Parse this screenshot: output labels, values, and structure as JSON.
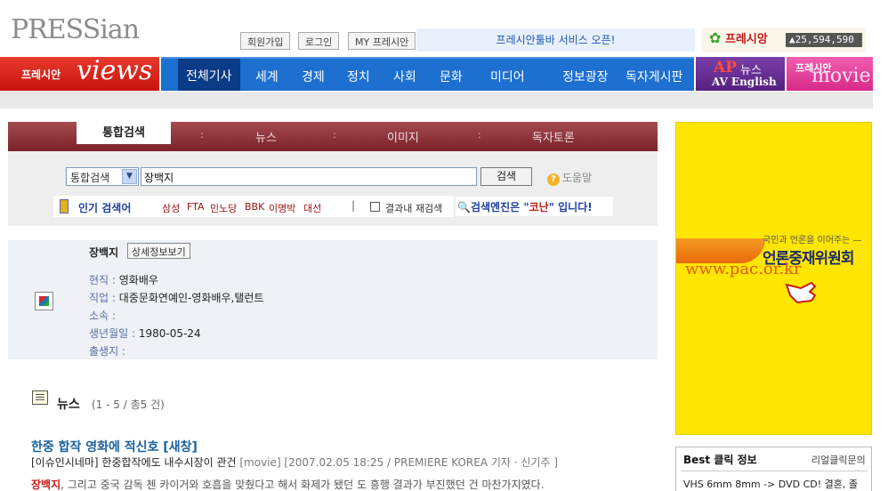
{
  "header": {
    "logo": "PRESSian",
    "links": [
      "회원가입",
      "로그인",
      "MY 프레시안"
    ],
    "banner": "프레시안툴바 서비스 오픈!",
    "counter_logo": "프레시앙",
    "counter_value": "▲25,594,590"
  },
  "nav": {
    "views_small": "프레시안",
    "views_big": "views",
    "items": [
      "전체기사",
      "세계",
      "경제",
      "정치",
      "사회",
      "문화",
      "미디어",
      "정보광장",
      "독자게시판"
    ],
    "ap_brand": "AP",
    "ap_label": "뉴스",
    "ap_sub": "AV English",
    "movie_small": "프레시안",
    "movie_big": "movie"
  },
  "search": {
    "tabs": [
      "통합검색",
      "뉴스",
      "이미지",
      "독자토론"
    ],
    "scope_value": "통합검색",
    "query": "장백지",
    "button": "검색",
    "help": "도움말",
    "popular_label": "인기 검색어",
    "popular": [
      "삼성",
      "FTA",
      "민노당",
      "BBK",
      "이명박",
      "대선"
    ],
    "research_label": "결과내 재검색",
    "engine_prefix": "검색엔진은 \"",
    "engine_name": "코난",
    "engine_suffix": "\" 입니다!"
  },
  "profile": {
    "name": "장백지",
    "detail_button": "상세정보보기",
    "rows": [
      {
        "key": "현직",
        "value": "영화배우"
      },
      {
        "key": "직업",
        "value": "대중문화연예인-영화배우,탤런트"
      },
      {
        "key": "소속",
        "value": ""
      },
      {
        "key": "생년월일",
        "value": "1980-05-24"
      },
      {
        "key": "출생지",
        "value": ""
      }
    ]
  },
  "news": {
    "heading": "뉴스",
    "count": "(1 - 5 / 총5 건)",
    "item": {
      "title": "한중 합작 영화에 적신호 [새창]",
      "source": "[이슈인시네마] 한중합작에도 내수시장이 관건",
      "meta": "[movie] [2007.02.05 18:25 / PREMIERE KOREA 기자 · 신기주 ]",
      "snippet_highlight": "장백지",
      "snippet_rest": ", 그리고 중국 감독 첸 카이거와 호흡을 맞췄다고 해서 화제가 됐던 도 흥행 결과가 부진했던 건 마찬가지였다."
    }
  },
  "ad": {
    "small": "국민과 언론을 이어주는 —",
    "main": "언론중재위원회",
    "url": "www.pac.or.kr"
  },
  "best": {
    "title": "Best 클릭 정보",
    "link": "리얼클릭문의",
    "item": "VHS 6mm 8mm -> DVD CD! 결혼, 졸"
  }
}
